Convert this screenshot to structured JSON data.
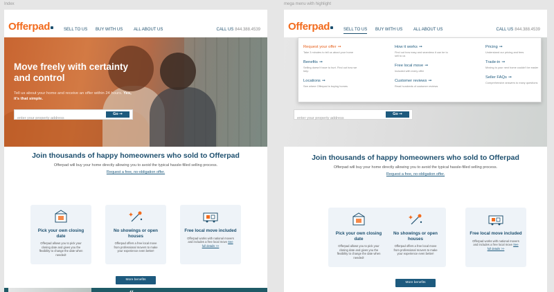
{
  "labels": {
    "left": "Index",
    "right": "mega menu with highlight"
  },
  "header": {
    "logo": "Offerpad",
    "nav": [
      "SELL TO US",
      "BUY WITH US",
      "ALL ABOUT US"
    ],
    "call_label": "CALL US",
    "call_number": "844.388.4539"
  },
  "hero": {
    "title": "Move freely with certainty and control",
    "sub": "Tell us about your home and receive an offer within 24 hours.",
    "sub_strong": "Yes, it's that simple.",
    "placeholder": "enter your property address",
    "go": "Go ➞"
  },
  "main": {
    "title": "Join thousands of happy homeowners who sold to Offerpad",
    "subtitle": "Offerpad will buy your home directly allowing you to avoid the typical hassle-filled selling process.",
    "link": "Request a free, no-obligation offer."
  },
  "cards": [
    {
      "title": "Pick your own closing date",
      "desc": "Offerpad allows you to pick your closing date and gives you the flexibility to change the date when needed!",
      "icon": "calendar-box-icon"
    },
    {
      "title": "No showings or open houses",
      "desc": "Offerpad offers a free local move from professional movers to make your experience even better!",
      "icon": "sparkle-house-icon"
    },
    {
      "title": "Free local move included",
      "desc": "Offerpad works with national movers and includes a free local move",
      "link": "See full details >>",
      "icon": "moving-truck-icon"
    }
  ],
  "more_benefits": "More benefits",
  "mega_menu": {
    "columns": [
      [
        {
          "title": "Request your offer",
          "desc": "Take 3 minutes to tell us about your home",
          "highlight": true
        },
        {
          "title": "Benefits",
          "desc": "Selling doesn't have to hurt. Find out how we help"
        },
        {
          "title": "Locations",
          "desc": "See where Offerpad is buying homes"
        }
      ],
      [
        {
          "title": "How it works",
          "desc": "Find out how easy and seamless it can be to sell to us"
        },
        {
          "title": "Free local move",
          "desc": "Included with every offer"
        },
        {
          "title": "Customer reviews",
          "desc": "Read hundreds of customer reviews"
        }
      ],
      [
        {
          "title": "Pricing",
          "desc": "Understand our pricing and fees"
        },
        {
          "title": "Trade-in",
          "desc": "Moving to your next home couldn't be easier"
        },
        {
          "title": "Seller FAQs",
          "desc": "Comprehensive answers to many questions"
        }
      ]
    ]
  },
  "colors": {
    "brand_orange": "#f26b1d",
    "brand_navy": "#1d4f6e",
    "button_blue": "#1d5a7e",
    "highlight": "#e65d17"
  }
}
